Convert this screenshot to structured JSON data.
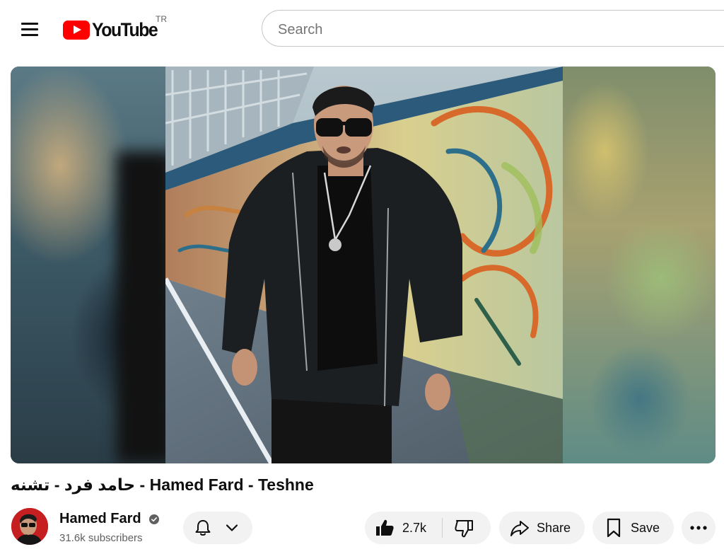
{
  "header": {
    "logo_text": "YouTube",
    "country_code": "TR",
    "search_placeholder": "Search"
  },
  "video": {
    "title_fa": "حامد فرد - تشنه",
    "title_separator": " - ",
    "title_en": "Hamed Fard - Teshne"
  },
  "channel": {
    "name": "Hamed Fard",
    "subscribers": "31.6k subscribers"
  },
  "actions": {
    "likes": "2.7k",
    "share_label": "Share",
    "save_label": "Save"
  },
  "colors": {
    "brand_red": "#ff0000",
    "pill_bg": "#f2f2f2",
    "text_primary": "#0f0f0f",
    "text_secondary": "#606060"
  },
  "icons": {
    "menu": "menu-icon",
    "bell": "bell-icon",
    "chevron": "chevron-down-icon",
    "like": "thumbs-up-icon",
    "dislike": "thumbs-down-icon",
    "share": "share-icon",
    "save": "bookmark-icon",
    "more": "more-horizontal-icon",
    "verified": "verified-icon"
  }
}
